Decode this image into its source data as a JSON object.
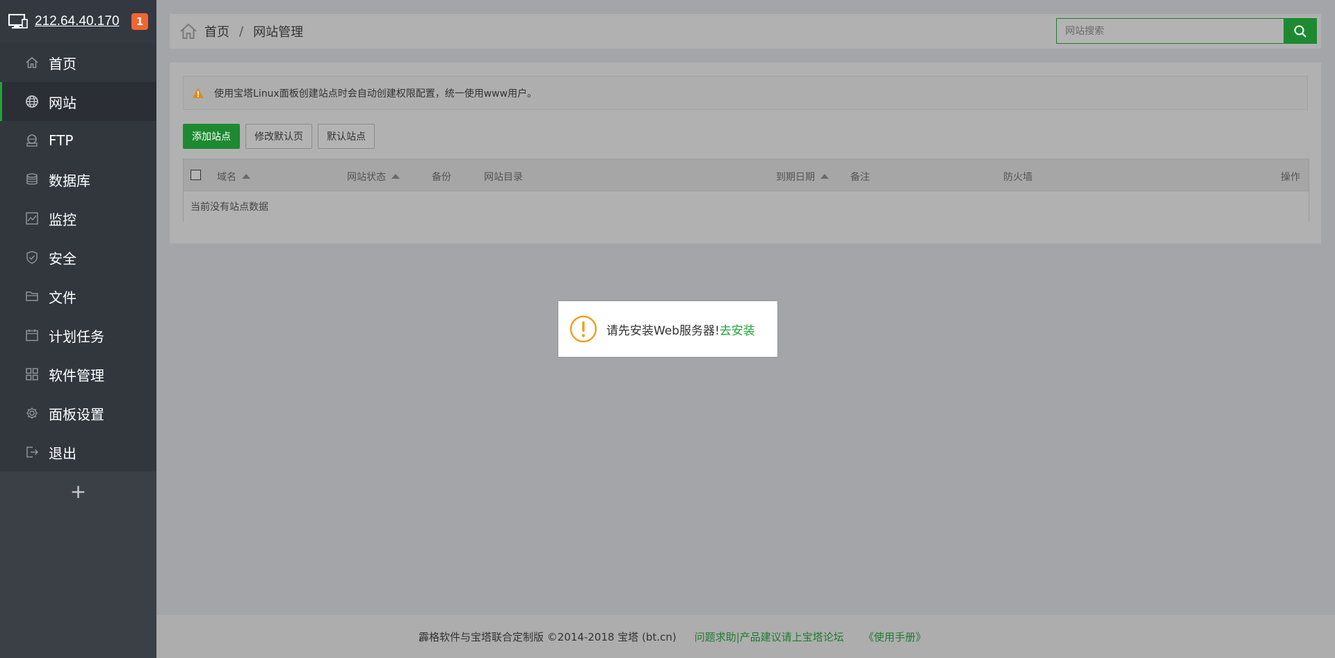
{
  "sidebar": {
    "ip": "212.64.40.170",
    "badge": "1",
    "items": [
      {
        "label": "首页",
        "icon": "home-icon"
      },
      {
        "label": "网站",
        "icon": "globe-icon"
      },
      {
        "label": "FTP",
        "icon": "ftp-icon"
      },
      {
        "label": "数据库",
        "icon": "database-icon"
      },
      {
        "label": "监控",
        "icon": "monitor-chart-icon"
      },
      {
        "label": "安全",
        "icon": "shield-icon"
      },
      {
        "label": "文件",
        "icon": "folder-icon"
      },
      {
        "label": "计划任务",
        "icon": "calendar-icon"
      },
      {
        "label": "软件管理",
        "icon": "grid-icon"
      },
      {
        "label": "面板设置",
        "icon": "gear-icon"
      },
      {
        "label": "退出",
        "icon": "logout-icon"
      }
    ],
    "active_index": 1,
    "add_label": "+"
  },
  "topbar": {
    "crumb_home": "首页",
    "crumb_sep": "/",
    "crumb_current": "网站管理",
    "search_placeholder": "网站搜索"
  },
  "notice": "使用宝塔Linux面板创建站点时会自动创建权限配置，统一使用www用户。",
  "buttons": {
    "add_site": "添加站点",
    "modify_default_page": "修改默认页",
    "default_site": "默认站点"
  },
  "table": {
    "columns": [
      "域名",
      "网站状态",
      "备份",
      "网站目录",
      "到期日期",
      "备注",
      "防火墙",
      "操作"
    ],
    "empty_text": "当前没有站点数据"
  },
  "toast": {
    "message": "请先安装Web服务器!",
    "link": "去安装"
  },
  "footer": {
    "copyright": "霹格软件与宝塔联合定制版 ©2014-2018 宝塔 (bt.cn)",
    "help_link": "问题求助|产品建议请上宝塔论坛",
    "manual_link": "《使用手册》"
  },
  "colors": {
    "accent_green": "#20a53a",
    "sidebar_bg": "#3b4047",
    "badge_orange": "#f26531",
    "warning_orange": "#f0a020"
  }
}
